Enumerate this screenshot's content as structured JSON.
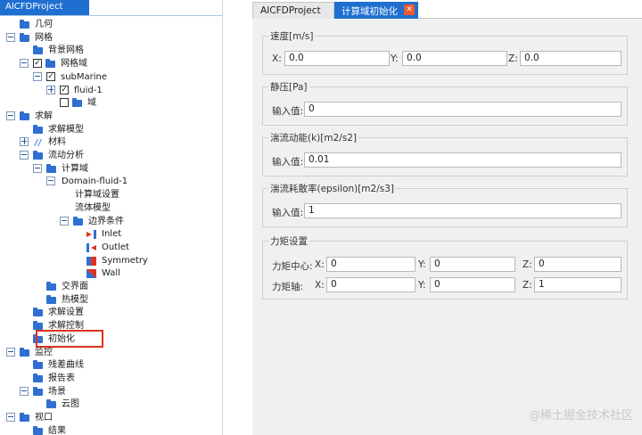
{
  "left_panel": {
    "tab_title": "AICFDProject",
    "tree": [
      {
        "label": "几何",
        "level": 0,
        "expander": null,
        "check": null,
        "icon": "folder"
      },
      {
        "label": "网格",
        "level": 0,
        "expander": "minus",
        "check": null,
        "icon": "folder"
      },
      {
        "label": "背景网格",
        "level": 1,
        "expander": null,
        "check": null,
        "icon": "folder"
      },
      {
        "label": "网格域",
        "level": 1,
        "expander": "minus",
        "check": true,
        "icon": "folder"
      },
      {
        "label": "subMarine",
        "level": 2,
        "expander": "minus",
        "check": true,
        "icon": null
      },
      {
        "label": "fluid-1",
        "level": 3,
        "expander": "plus",
        "check": true,
        "icon": null
      },
      {
        "label": "域",
        "level": 3,
        "expander": null,
        "check": false,
        "icon": "folder"
      },
      {
        "label": "求解",
        "level": 0,
        "expander": "minus",
        "check": null,
        "icon": "folder"
      },
      {
        "label": "求解模型",
        "level": 1,
        "expander": null,
        "check": null,
        "icon": "folder"
      },
      {
        "label": "材料",
        "level": 1,
        "expander": "plus",
        "check": null,
        "icon": "material"
      },
      {
        "label": "流动分析",
        "level": 1,
        "expander": "minus",
        "check": null,
        "icon": "folder"
      },
      {
        "label": "计算域",
        "level": 2,
        "expander": "minus",
        "check": null,
        "icon": "folder"
      },
      {
        "label": "Domain-fluid-1",
        "level": 3,
        "expander": "minus",
        "check": null,
        "icon": null
      },
      {
        "label": "计算域设置",
        "level": 4,
        "expander": null,
        "check": null,
        "icon": null
      },
      {
        "label": "流体模型",
        "level": 4,
        "expander": null,
        "check": null,
        "icon": null
      },
      {
        "label": "边界条件",
        "level": 4,
        "expander": "minus",
        "check": null,
        "icon": "folder"
      },
      {
        "label": "Inlet",
        "level": 5,
        "expander": null,
        "check": null,
        "icon": "inlet"
      },
      {
        "label": "Outlet",
        "level": 5,
        "expander": null,
        "check": null,
        "icon": "outlet"
      },
      {
        "label": "Symmetry",
        "level": 5,
        "expander": null,
        "check": null,
        "icon": "symmetry"
      },
      {
        "label": "Wall",
        "level": 5,
        "expander": null,
        "check": null,
        "icon": "wall"
      },
      {
        "label": "交界面",
        "level": 2,
        "expander": null,
        "check": null,
        "icon": "folder"
      },
      {
        "label": "热模型",
        "level": 2,
        "expander": null,
        "check": null,
        "icon": "folder"
      },
      {
        "label": "求解设置",
        "level": 1,
        "expander": null,
        "check": null,
        "icon": "folder"
      },
      {
        "label": "求解控制",
        "level": 1,
        "expander": null,
        "check": null,
        "icon": "folder"
      },
      {
        "label": "初始化",
        "level": 1,
        "expander": null,
        "check": null,
        "icon": "folder",
        "highlighted": true
      },
      {
        "label": "监控",
        "level": 0,
        "expander": "minus",
        "check": null,
        "icon": "folder"
      },
      {
        "label": "残差曲线",
        "level": 1,
        "expander": null,
        "check": null,
        "icon": "folder"
      },
      {
        "label": "报告表",
        "level": 1,
        "expander": null,
        "check": null,
        "icon": "folder"
      },
      {
        "label": "场景",
        "level": 1,
        "expander": "minus",
        "check": null,
        "icon": "folder"
      },
      {
        "label": "云图",
        "level": 2,
        "expander": null,
        "check": null,
        "icon": "folder"
      },
      {
        "label": "视口",
        "level": 0,
        "expander": "minus",
        "check": null,
        "icon": "folder"
      },
      {
        "label": "结果",
        "level": 1,
        "expander": null,
        "check": null,
        "icon": "folder"
      }
    ]
  },
  "right_panel": {
    "tabs": [
      {
        "label": "AICFDProject",
        "active": false
      },
      {
        "label": "计算域初始化",
        "active": true,
        "close": "✕"
      }
    ],
    "velocity": {
      "title": "速度[m/s]",
      "x_label": "X:",
      "x_value": "0.0",
      "y_label": "Y:",
      "y_value": "0.0",
      "z_label": "Z:",
      "z_value": "0.0"
    },
    "pressure": {
      "title": "静压[Pa]",
      "input_label": "输入值:",
      "value": "0"
    },
    "tke": {
      "title": "湍流动能(k)[m2/s2]",
      "input_label": "输入值:",
      "value": "0.01"
    },
    "epsilon": {
      "title": "湍流耗散率(epsilon)[m2/s3]",
      "input_label": "输入值:",
      "value": "1"
    },
    "moment": {
      "title": "力矩设置",
      "center_label": "力矩中心:",
      "axis_label": "力矩轴:",
      "x_label": "X:",
      "y_label": "Y:",
      "z_label": "Z:",
      "center": {
        "x": "0",
        "y": "0",
        "z": "0"
      },
      "axis": {
        "x": "0",
        "y": "0",
        "z": "1"
      }
    }
  },
  "watermark": "@稀土掘金技术社区",
  "colors": {
    "accent_blue": "#1f6fd0",
    "folder_blue": "#2f6fd1",
    "highlight_red": "#e0301e",
    "close_orange": "#ef5b2e"
  }
}
